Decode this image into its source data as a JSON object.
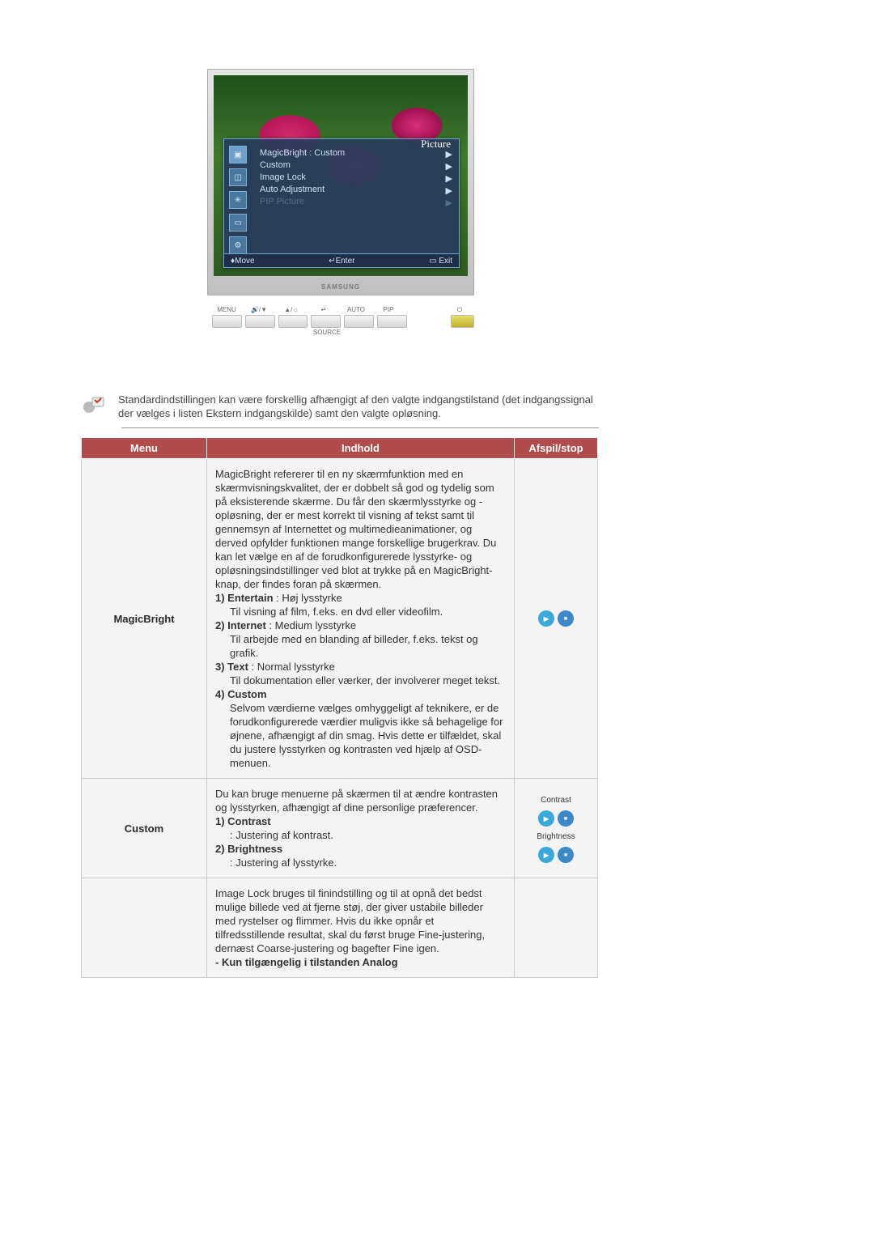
{
  "monitor": {
    "brand": "SAMSUNG",
    "osd": {
      "title": "Picture",
      "line1": "MagicBright    : Custom",
      "line2": "Custom",
      "line3": "Image Lock",
      "line4": "Auto Adjustment",
      "line5": "PIP Picture",
      "footer_move": "Move",
      "footer_enter": "Enter",
      "footer_exit": "Exit"
    },
    "buttons": {
      "menu": "MENU",
      "source": "SOURCE",
      "auto": "AUTO",
      "pip": "PIP"
    }
  },
  "info_text": "Standardindstillingen kan være forskellig afhængigt af den valgte indgangstilstand (det indgangssignal der vælges i listen Ekstern indgangskilde) samt den valgte opløsning.",
  "headers": {
    "menu": "Menu",
    "content": "Indhold",
    "play": "Afspil/stop"
  },
  "rows": {
    "magicbright": {
      "name": "MagicBright",
      "intro": "MagicBright refererer til en ny skærmfunktion med en skærmvisningskvalitet, der er dobbelt så god og tydelig som på eksisterende skærme. Du får den skærmlysstyrke og -opløsning, der er mest korrekt til visning af tekst samt til gennemsyn af Internettet og multimedieanimationer, og derved opfylder funktionen mange forskellige brugerkrav. Du kan let vælge en af de forudkonfigurerede lysstyrke- og opløsningsindstillinger ved blot at trykke på en MagicBright-knap, der findes foran på skærmen.",
      "opt1_title": "1) Entertain",
      "opt1_desc_head": " : Høj lysstyrke",
      "opt1_body": "Til visning af film, f.eks. en dvd eller videofilm.",
      "opt2_title": "2) Internet",
      "opt2_desc_head": " : Medium lysstyrke",
      "opt2_body": "Til arbejde med en blanding af billeder, f.eks. tekst og grafik.",
      "opt3_title": "3) Text",
      "opt3_desc_head": " : Normal lysstyrke",
      "opt3_body": "Til dokumentation eller værker, der involverer meget tekst.",
      "opt4_title": "4) Custom",
      "opt4_body": "Selvom værdierne vælges omhyggeligt af teknikere, er de forudkonfigurerede værdier muligvis ikke så behagelige for øjnene, afhængigt af din smag. Hvis dette er tilfældet, skal du justere lysstyrken og kontrasten ved hjælp af OSD-menuen."
    },
    "custom": {
      "name": "Custom",
      "intro": "Du kan bruge menuerne på skærmen til at ændre kontrasten og lysstyrken, afhængigt af dine personlige præferencer.",
      "c_title": "1) Contrast",
      "c_body": ": Justering af kontrast.",
      "b_title": "2) Brightness",
      "b_body": ": Justering af lysstyrke.",
      "cap_contrast": "Contrast",
      "cap_brightness": "Brightness"
    },
    "imagelock": {
      "intro": "Image Lock bruges til finindstilling og til at opnå det bedst mulige billede ved at fjerne støj, der giver ustabile billeder med rystelser og flimmer. Hvis du ikke opnår et tilfredsstillende resultat, skal du først bruge Fine-justering, dernæst Coarse-justering og bagefter Fine igen.",
      "note": "- Kun tilgængelig i tilstanden Analog"
    }
  }
}
